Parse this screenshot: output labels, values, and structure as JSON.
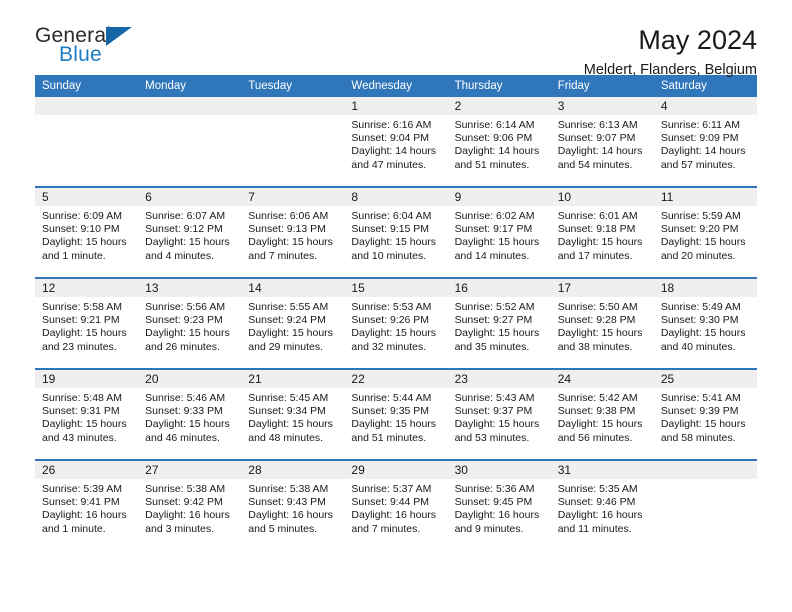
{
  "brand": {
    "name_part1": "General",
    "name_part2": "Blue",
    "triangle_color": "#1565a8",
    "accent_color": "#2f76bb"
  },
  "header": {
    "title": "May 2024",
    "subtitle": "Meldert, Flanders, Belgium"
  },
  "weekday_headers": [
    "Sunday",
    "Monday",
    "Tuesday",
    "Wednesday",
    "Thursday",
    "Friday",
    "Saturday"
  ],
  "labels": {
    "sunrise_prefix": "Sunrise:",
    "sunset_prefix": "Sunset:",
    "daylight_prefix": "Daylight:"
  },
  "weeks": [
    [
      {
        "day": "",
        "sunrise": "",
        "sunset": "",
        "daylight_line1": "",
        "daylight_line2": ""
      },
      {
        "day": "",
        "sunrise": "",
        "sunset": "",
        "daylight_line1": "",
        "daylight_line2": ""
      },
      {
        "day": "",
        "sunrise": "",
        "sunset": "",
        "daylight_line1": "",
        "daylight_line2": ""
      },
      {
        "day": "1",
        "sunrise": "Sunrise: 6:16 AM",
        "sunset": "Sunset: 9:04 PM",
        "daylight_line1": "Daylight: 14 hours",
        "daylight_line2": "and 47 minutes."
      },
      {
        "day": "2",
        "sunrise": "Sunrise: 6:14 AM",
        "sunset": "Sunset: 9:06 PM",
        "daylight_line1": "Daylight: 14 hours",
        "daylight_line2": "and 51 minutes."
      },
      {
        "day": "3",
        "sunrise": "Sunrise: 6:13 AM",
        "sunset": "Sunset: 9:07 PM",
        "daylight_line1": "Daylight: 14 hours",
        "daylight_line2": "and 54 minutes."
      },
      {
        "day": "4",
        "sunrise": "Sunrise: 6:11 AM",
        "sunset": "Sunset: 9:09 PM",
        "daylight_line1": "Daylight: 14 hours",
        "daylight_line2": "and 57 minutes."
      }
    ],
    [
      {
        "day": "5",
        "sunrise": "Sunrise: 6:09 AM",
        "sunset": "Sunset: 9:10 PM",
        "daylight_line1": "Daylight: 15 hours",
        "daylight_line2": "and 1 minute."
      },
      {
        "day": "6",
        "sunrise": "Sunrise: 6:07 AM",
        "sunset": "Sunset: 9:12 PM",
        "daylight_line1": "Daylight: 15 hours",
        "daylight_line2": "and 4 minutes."
      },
      {
        "day": "7",
        "sunrise": "Sunrise: 6:06 AM",
        "sunset": "Sunset: 9:13 PM",
        "daylight_line1": "Daylight: 15 hours",
        "daylight_line2": "and 7 minutes."
      },
      {
        "day": "8",
        "sunrise": "Sunrise: 6:04 AM",
        "sunset": "Sunset: 9:15 PM",
        "daylight_line1": "Daylight: 15 hours",
        "daylight_line2": "and 10 minutes."
      },
      {
        "day": "9",
        "sunrise": "Sunrise: 6:02 AM",
        "sunset": "Sunset: 9:17 PM",
        "daylight_line1": "Daylight: 15 hours",
        "daylight_line2": "and 14 minutes."
      },
      {
        "day": "10",
        "sunrise": "Sunrise: 6:01 AM",
        "sunset": "Sunset: 9:18 PM",
        "daylight_line1": "Daylight: 15 hours",
        "daylight_line2": "and 17 minutes."
      },
      {
        "day": "11",
        "sunrise": "Sunrise: 5:59 AM",
        "sunset": "Sunset: 9:20 PM",
        "daylight_line1": "Daylight: 15 hours",
        "daylight_line2": "and 20 minutes."
      }
    ],
    [
      {
        "day": "12",
        "sunrise": "Sunrise: 5:58 AM",
        "sunset": "Sunset: 9:21 PM",
        "daylight_line1": "Daylight: 15 hours",
        "daylight_line2": "and 23 minutes."
      },
      {
        "day": "13",
        "sunrise": "Sunrise: 5:56 AM",
        "sunset": "Sunset: 9:23 PM",
        "daylight_line1": "Daylight: 15 hours",
        "daylight_line2": "and 26 minutes."
      },
      {
        "day": "14",
        "sunrise": "Sunrise: 5:55 AM",
        "sunset": "Sunset: 9:24 PM",
        "daylight_line1": "Daylight: 15 hours",
        "daylight_line2": "and 29 minutes."
      },
      {
        "day": "15",
        "sunrise": "Sunrise: 5:53 AM",
        "sunset": "Sunset: 9:26 PM",
        "daylight_line1": "Daylight: 15 hours",
        "daylight_line2": "and 32 minutes."
      },
      {
        "day": "16",
        "sunrise": "Sunrise: 5:52 AM",
        "sunset": "Sunset: 9:27 PM",
        "daylight_line1": "Daylight: 15 hours",
        "daylight_line2": "and 35 minutes."
      },
      {
        "day": "17",
        "sunrise": "Sunrise: 5:50 AM",
        "sunset": "Sunset: 9:28 PM",
        "daylight_line1": "Daylight: 15 hours",
        "daylight_line2": "and 38 minutes."
      },
      {
        "day": "18",
        "sunrise": "Sunrise: 5:49 AM",
        "sunset": "Sunset: 9:30 PM",
        "daylight_line1": "Daylight: 15 hours",
        "daylight_line2": "and 40 minutes."
      }
    ],
    [
      {
        "day": "19",
        "sunrise": "Sunrise: 5:48 AM",
        "sunset": "Sunset: 9:31 PM",
        "daylight_line1": "Daylight: 15 hours",
        "daylight_line2": "and 43 minutes."
      },
      {
        "day": "20",
        "sunrise": "Sunrise: 5:46 AM",
        "sunset": "Sunset: 9:33 PM",
        "daylight_line1": "Daylight: 15 hours",
        "daylight_line2": "and 46 minutes."
      },
      {
        "day": "21",
        "sunrise": "Sunrise: 5:45 AM",
        "sunset": "Sunset: 9:34 PM",
        "daylight_line1": "Daylight: 15 hours",
        "daylight_line2": "and 48 minutes."
      },
      {
        "day": "22",
        "sunrise": "Sunrise: 5:44 AM",
        "sunset": "Sunset: 9:35 PM",
        "daylight_line1": "Daylight: 15 hours",
        "daylight_line2": "and 51 minutes."
      },
      {
        "day": "23",
        "sunrise": "Sunrise: 5:43 AM",
        "sunset": "Sunset: 9:37 PM",
        "daylight_line1": "Daylight: 15 hours",
        "daylight_line2": "and 53 minutes."
      },
      {
        "day": "24",
        "sunrise": "Sunrise: 5:42 AM",
        "sunset": "Sunset: 9:38 PM",
        "daylight_line1": "Daylight: 15 hours",
        "daylight_line2": "and 56 minutes."
      },
      {
        "day": "25",
        "sunrise": "Sunrise: 5:41 AM",
        "sunset": "Sunset: 9:39 PM",
        "daylight_line1": "Daylight: 15 hours",
        "daylight_line2": "and 58 minutes."
      }
    ],
    [
      {
        "day": "26",
        "sunrise": "Sunrise: 5:39 AM",
        "sunset": "Sunset: 9:41 PM",
        "daylight_line1": "Daylight: 16 hours",
        "daylight_line2": "and 1 minute."
      },
      {
        "day": "27",
        "sunrise": "Sunrise: 5:38 AM",
        "sunset": "Sunset: 9:42 PM",
        "daylight_line1": "Daylight: 16 hours",
        "daylight_line2": "and 3 minutes."
      },
      {
        "day": "28",
        "sunrise": "Sunrise: 5:38 AM",
        "sunset": "Sunset: 9:43 PM",
        "daylight_line1": "Daylight: 16 hours",
        "daylight_line2": "and 5 minutes."
      },
      {
        "day": "29",
        "sunrise": "Sunrise: 5:37 AM",
        "sunset": "Sunset: 9:44 PM",
        "daylight_line1": "Daylight: 16 hours",
        "daylight_line2": "and 7 minutes."
      },
      {
        "day": "30",
        "sunrise": "Sunrise: 5:36 AM",
        "sunset": "Sunset: 9:45 PM",
        "daylight_line1": "Daylight: 16 hours",
        "daylight_line2": "and 9 minutes."
      },
      {
        "day": "31",
        "sunrise": "Sunrise: 5:35 AM",
        "sunset": "Sunset: 9:46 PM",
        "daylight_line1": "Daylight: 16 hours",
        "daylight_line2": "and 11 minutes."
      },
      {
        "day": "",
        "sunrise": "",
        "sunset": "",
        "daylight_line1": "",
        "daylight_line2": ""
      }
    ]
  ]
}
